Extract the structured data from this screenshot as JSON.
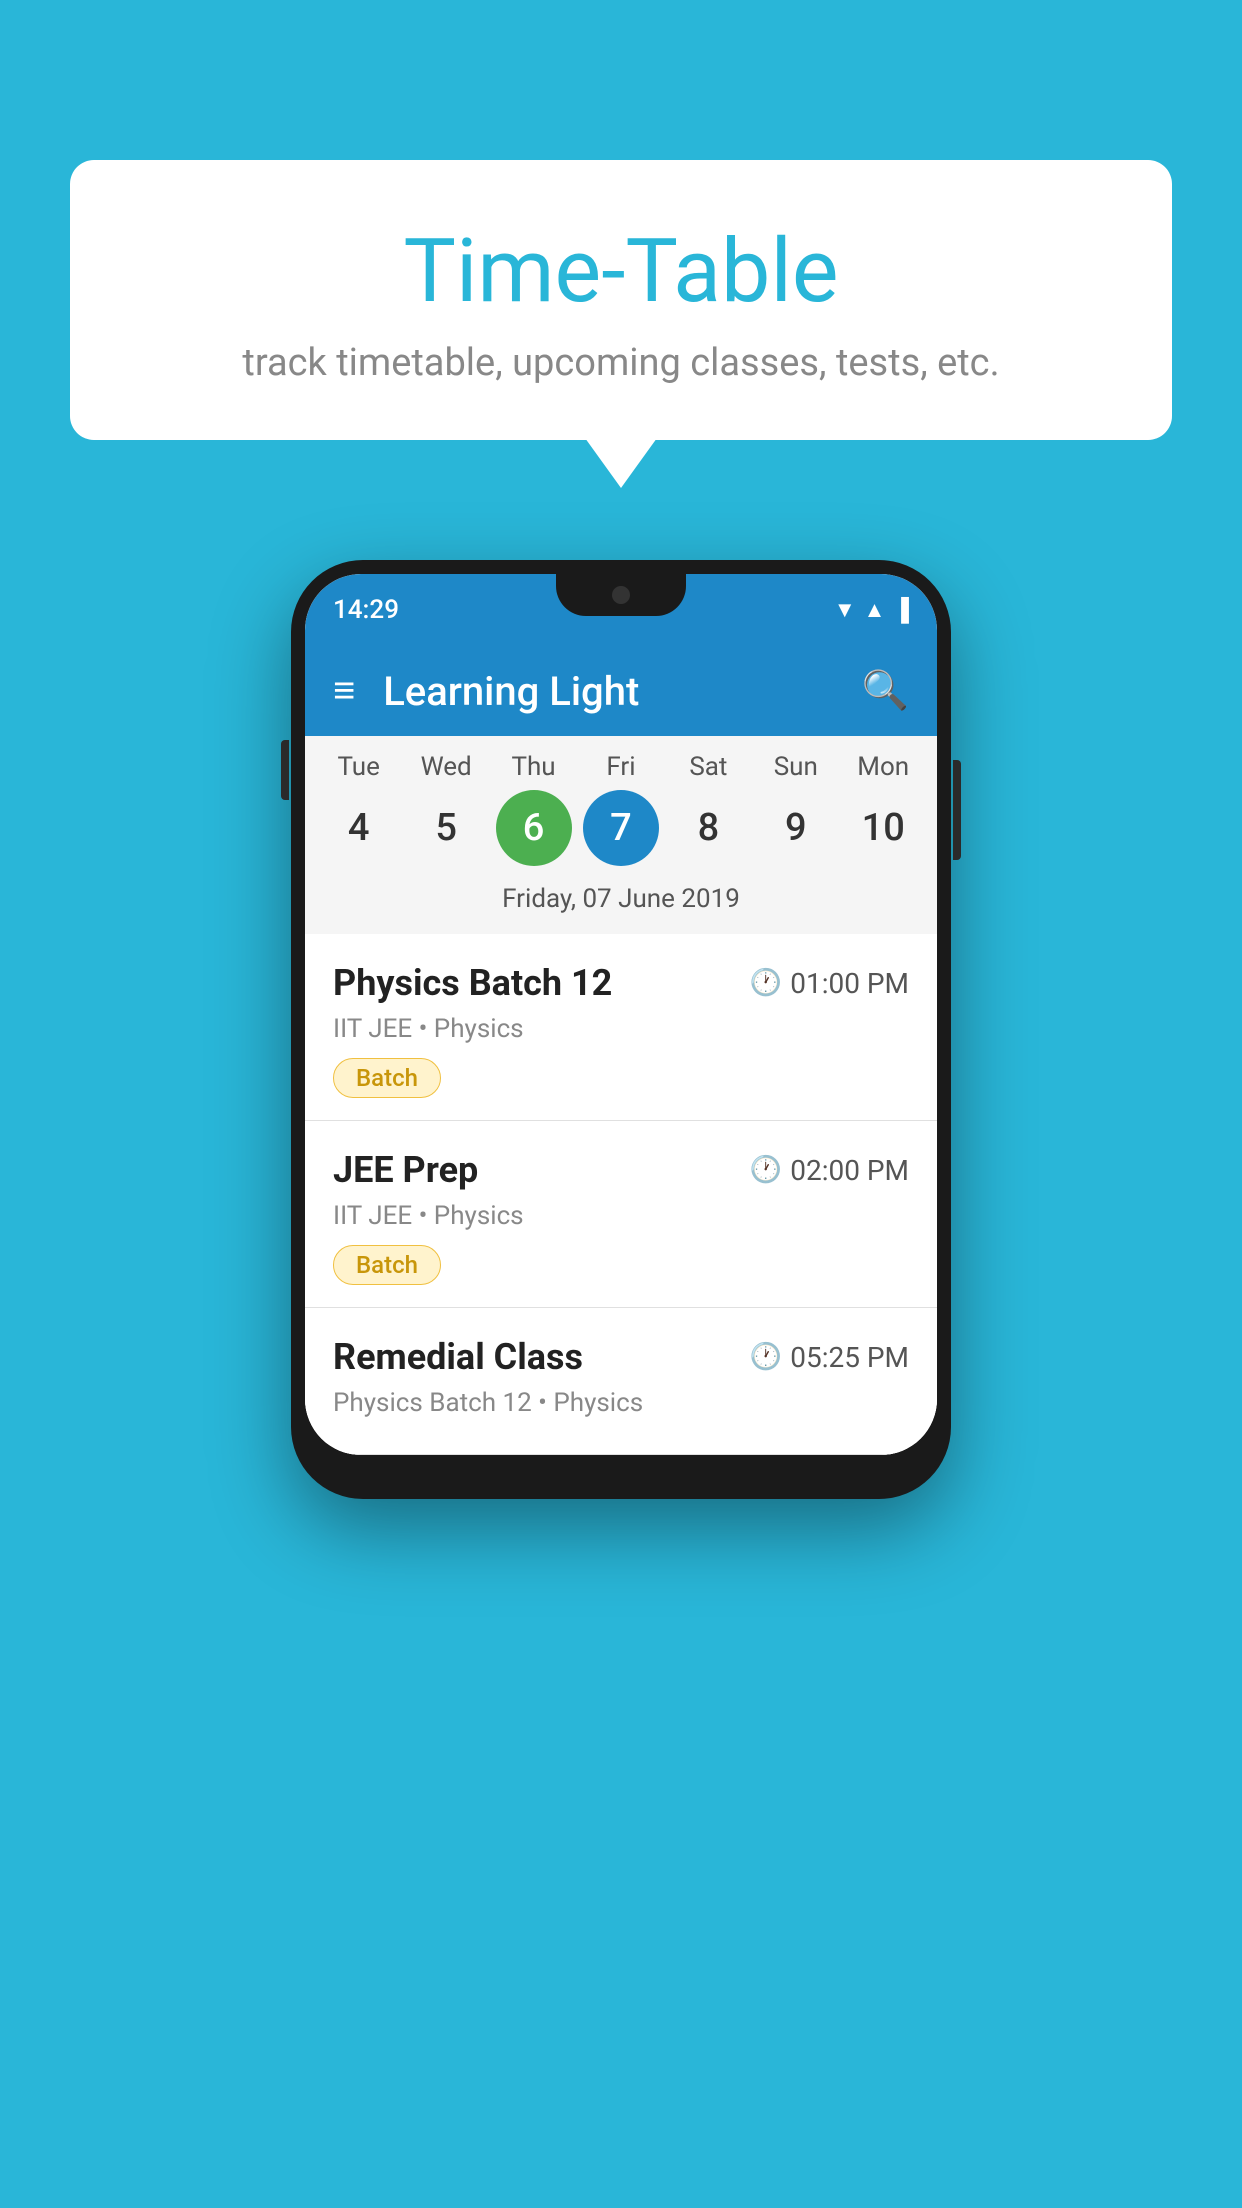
{
  "background_color": "#29b6d8",
  "speech_bubble": {
    "title": "Time-Table",
    "subtitle": "track timetable, upcoming classes, tests, etc."
  },
  "phone": {
    "status_bar": {
      "time": "14:29"
    },
    "app_bar": {
      "title": "Learning Light"
    },
    "calendar": {
      "days": [
        {
          "label": "Tue",
          "num": "4"
        },
        {
          "label": "Wed",
          "num": "5"
        },
        {
          "label": "Thu",
          "num": "6",
          "state": "today"
        },
        {
          "label": "Fri",
          "num": "7",
          "state": "selected"
        },
        {
          "label": "Sat",
          "num": "8"
        },
        {
          "label": "Sun",
          "num": "9"
        },
        {
          "label": "Mon",
          "num": "10"
        }
      ],
      "date_label": "Friday, 07 June 2019"
    },
    "events": [
      {
        "title": "Physics Batch 12",
        "time": "01:00 PM",
        "subtitle": "IIT JEE • Physics",
        "badge": "Batch"
      },
      {
        "title": "JEE Prep",
        "time": "02:00 PM",
        "subtitle": "IIT JEE • Physics",
        "badge": "Batch"
      },
      {
        "title": "Remedial Class",
        "time": "05:25 PM",
        "subtitle": "Physics Batch 12 • Physics",
        "badge": null
      }
    ]
  }
}
